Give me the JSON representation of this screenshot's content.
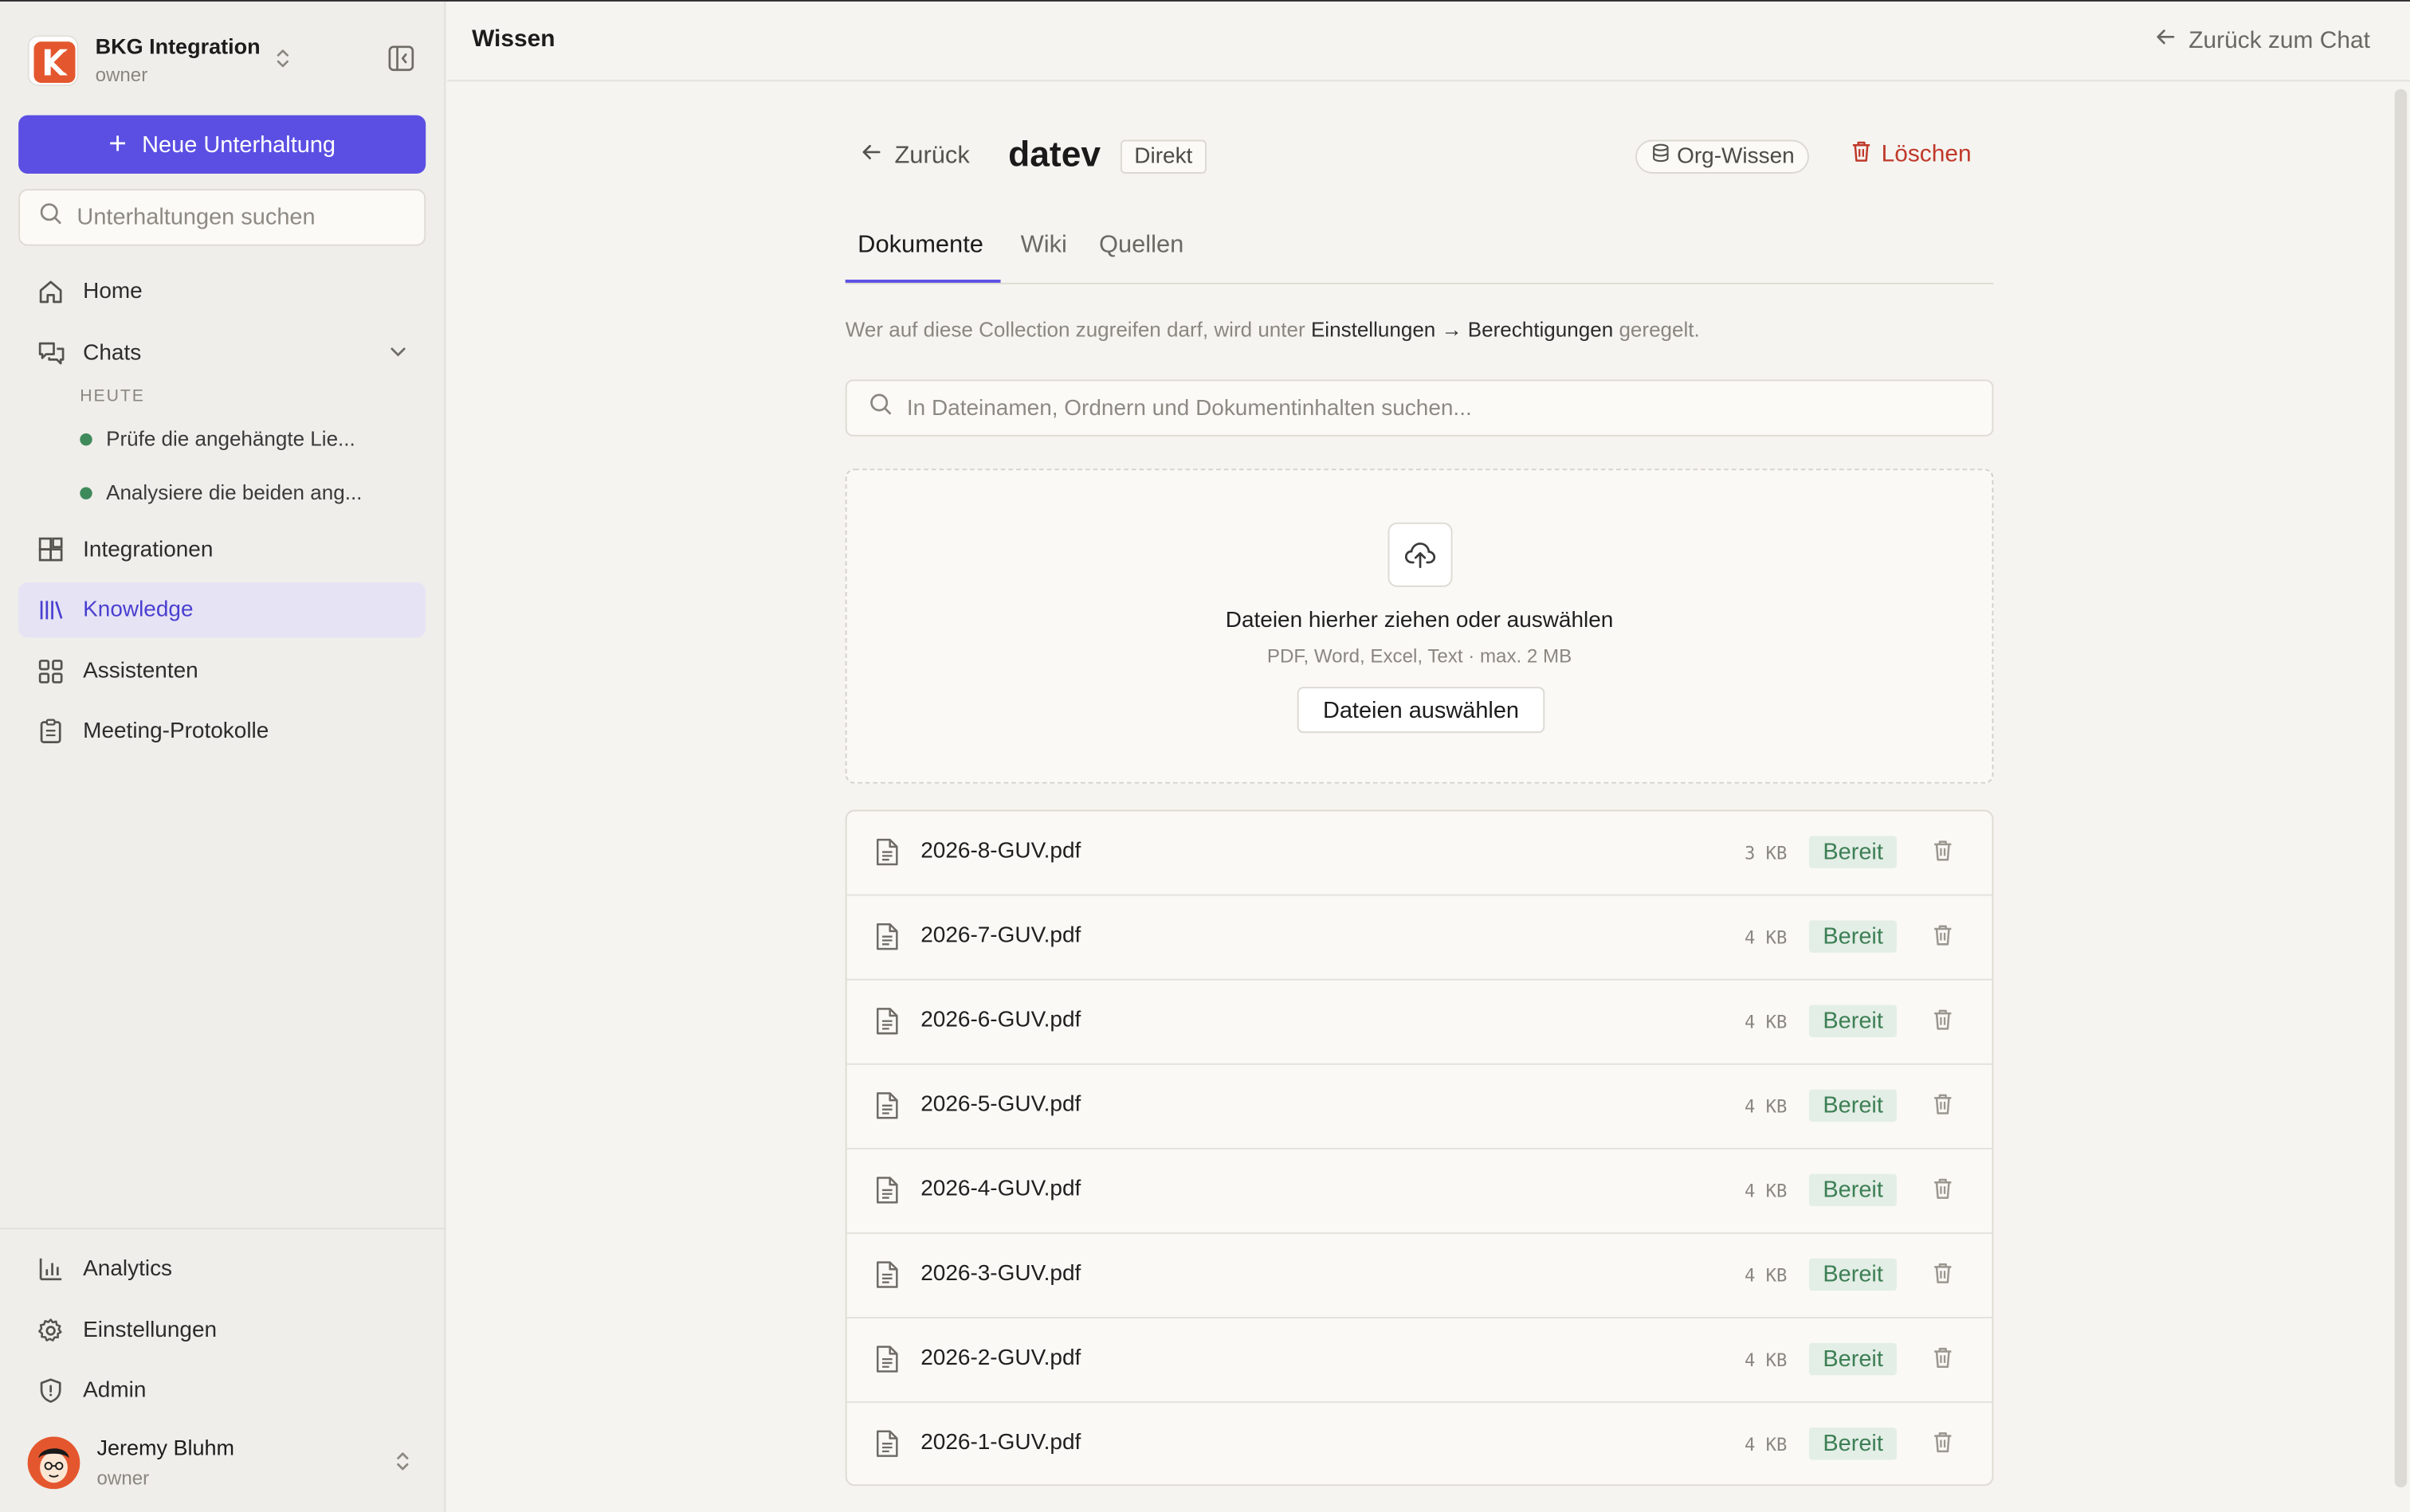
{
  "sidebar": {
    "org_name": "BKG Integration",
    "org_role": "owner",
    "new_chat_label": "Neue Unterhaltung",
    "search_placeholder": "Unterhaltungen suchen",
    "nav": {
      "home": "Home",
      "chats": "Chats",
      "today": "HEUTE",
      "chat1": "Prüfe die angehängte Lie...",
      "chat2": "Analysiere die beiden ang...",
      "integrations": "Integrationen",
      "knowledge": "Knowledge",
      "assistants": "Assistenten",
      "meetings": "Meeting-Protokolle",
      "analytics": "Analytics",
      "settings": "Einstellungen",
      "admin": "Admin"
    },
    "user_name": "Jeremy Bluhm",
    "user_role": "owner",
    "colors": {
      "accent": "#5b4fe3",
      "active_bg": "#e6e4f4",
      "logo": "#e4572e"
    }
  },
  "header": {
    "title": "Wissen",
    "back_to_chat": "Zurück zum Chat"
  },
  "collection": {
    "back_label": "Zurück",
    "name": "datev",
    "type_badge": "Direkt",
    "scope_badge": "Org-Wissen",
    "delete_label": "Löschen",
    "tabs": [
      "Dokumente",
      "Wiki",
      "Quellen"
    ],
    "info_pre": "Wer auf diese Collection zugreifen darf, wird unter",
    "info_link": "Einstellungen → Berechtigungen",
    "info_post": "geregelt.",
    "search_placeholder": "In Dateinamen, Ordnern und Dokumentinhalten suchen...",
    "dropzone_title": "Dateien hierher ziehen oder auswählen",
    "dropzone_sub": "PDF, Word, Excel, Text · max. 2 MB",
    "dropzone_button": "Dateien auswählen",
    "files": [
      {
        "name": "2026-8-GUV.pdf",
        "size": "3 KB",
        "status": "Bereit"
      },
      {
        "name": "2026-7-GUV.pdf",
        "size": "4 KB",
        "status": "Bereit"
      },
      {
        "name": "2026-6-GUV.pdf",
        "size": "4 KB",
        "status": "Bereit"
      },
      {
        "name": "2026-5-GUV.pdf",
        "size": "4 KB",
        "status": "Bereit"
      },
      {
        "name": "2026-4-GUV.pdf",
        "size": "4 KB",
        "status": "Bereit"
      },
      {
        "name": "2026-3-GUV.pdf",
        "size": "4 KB",
        "status": "Bereit"
      },
      {
        "name": "2026-2-GUV.pdf",
        "size": "4 KB",
        "status": "Bereit"
      },
      {
        "name": "2026-1-GUV.pdf",
        "size": "4 KB",
        "status": "Bereit"
      }
    ],
    "colors": {
      "status_bg": "#e3eee6",
      "status_text": "#3d7f55",
      "delete": "#c0392b"
    }
  }
}
